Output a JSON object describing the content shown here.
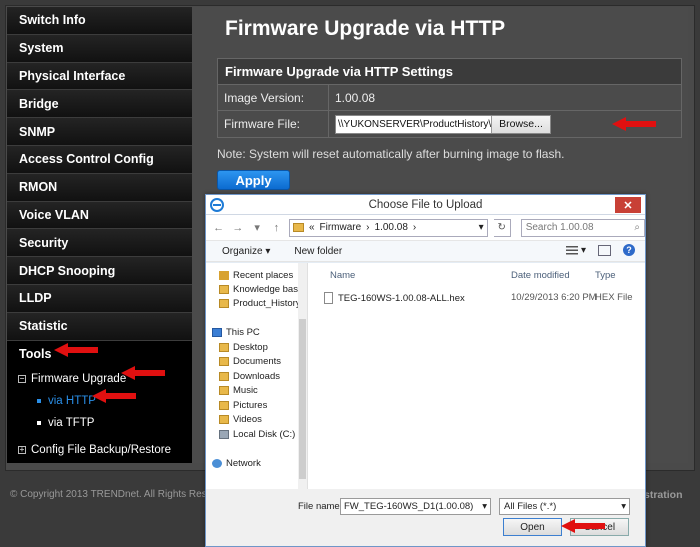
{
  "sidebar": {
    "items": [
      "Switch Info",
      "System",
      "Physical Interface",
      "Bridge",
      "SNMP",
      "Access Control Config",
      "RMON",
      "Voice VLAN",
      "Security",
      "DHCP Snooping",
      "LLDP",
      "Statistic"
    ],
    "active": "Tools",
    "sub_expanded": "Firmware Upgrade",
    "sub_expanded_icon": "−",
    "children": [
      "via HTTP",
      "via TFTP"
    ],
    "sub_collapsed": "Config File Backup/Restore",
    "sub_collapsed_icon": "+"
  },
  "main": {
    "title": "Firmware Upgrade via HTTP",
    "settings_heading": "Firmware Upgrade via HTTP Settings",
    "image_version_label": "Image Version:",
    "image_version_value": "1.00.08",
    "firmware_file_label": "Firmware File:",
    "firmware_file_path": "\\\\YUKONSERVER\\ProductHistory\\Product_Histo",
    "browse_label": "Browse...",
    "note": "Note: System will reset automatically after burning image to flash.",
    "apply_label": "Apply"
  },
  "footer": {
    "copyright": "© Copyright 2013 TRENDnet. All Rights Res",
    "right_text": "stration"
  },
  "dialog": {
    "title": "Choose File to Upload",
    "close": "✕",
    "back": "←",
    "forward": "→",
    "recent": "▾",
    "up": "↑",
    "breadcrumb": [
      "«",
      "Firmware",
      "›",
      "1.00.08",
      "›"
    ],
    "address_dropdown": "▾",
    "refresh": "↻",
    "search_placeholder": "Search 1.00.08",
    "search_icon": "⌕",
    "organize": "Organize ▾",
    "new_folder": "New folder",
    "view_menu": "▾",
    "help": "?",
    "tree": [
      "Recent places",
      "Knowledge base",
      "Product_History",
      "This PC",
      "Desktop",
      "Documents",
      "Downloads",
      "Music",
      "Pictures",
      "Videos",
      "Local Disk (C:)",
      "Network"
    ],
    "columns": [
      "Name",
      "Date modified",
      "Type"
    ],
    "files": [
      {
        "name": "TEG-160WS-1.00.08-ALL.hex",
        "date": "10/29/2013 6:20 PM",
        "type": "HEX File"
      }
    ],
    "file_name_label": "File name:",
    "file_name_value": "FW_TEG-160WS_D1(1.00.08)",
    "file_type": "All Files (*.*)",
    "dropdown_arrow": "▾",
    "open_label": "Open",
    "cancel_label": "Cancel"
  },
  "colors": {
    "accent": "#2a8fe8",
    "arrow": "#e01010",
    "apply": "#1a7ee0"
  }
}
